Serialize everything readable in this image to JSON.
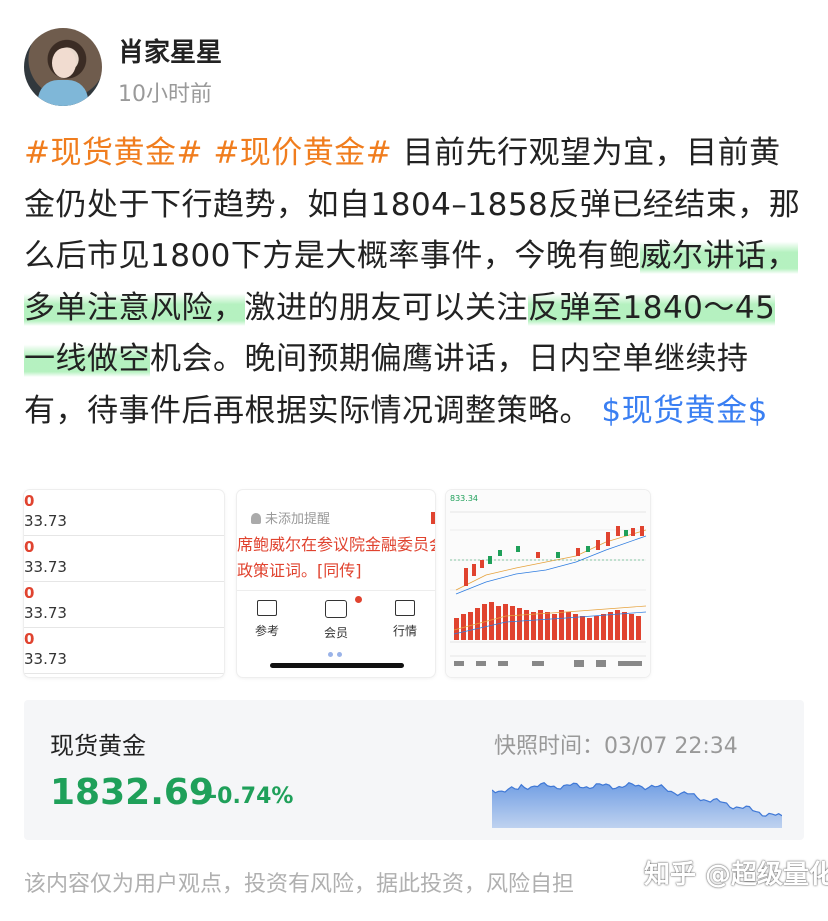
{
  "author": {
    "name": "肖家星星",
    "time": "10小时前"
  },
  "post": {
    "tag1": "#现货黄金#",
    "tag2": "#现价黄金#",
    "text1": " 目前先行观望为宜，目前黄金仍处于下行趋势，如自1804–1858反弹已经结束，那么后市见1800下方是大概率事件，今晚有鲍",
    "hl1": "威尔讲话，多单注意风险，",
    "text2": "激进的朋友可以关注",
    "hl2": "反弹至1840～45一线做空",
    "text3": "机会。晚间预期偏鹰讲话，日内空单继续持有，待事件后再根据实际情况调整策略。",
    "stock": "$现货黄金$"
  },
  "thumbs": {
    "t1_rows": [
      {
        "a": "0",
        "b": "33.73"
      },
      {
        "a": "0",
        "b": "33.73"
      },
      {
        "a": "0",
        "b": "33.73"
      },
      {
        "a": "0",
        "b": "33.73"
      }
    ],
    "t2": {
      "remind": "未添加提醒",
      "news_line1": "席鲍威尔在参议院金融委员会",
      "news_line2": "政策证词。[同传]",
      "nav": [
        "参考",
        "会员",
        "行情"
      ]
    },
    "t3": {
      "price": "833.34"
    }
  },
  "quote": {
    "name": "现货黄金",
    "price": "1832.69",
    "change": "-0.74%",
    "snapshot": "快照时间：03/07 22:34",
    "spark_color": "#5a8fe0"
  },
  "footer": {
    "disclaimer": "该内容仅为用户观点，投资有风险，据此投资，风险自担",
    "watermark": "知乎 @超级量化星"
  },
  "colors": {
    "tag": "#f07d1e",
    "stock": "#3a7ff2",
    "up": "#e0432f",
    "down": "#1fa05a"
  }
}
